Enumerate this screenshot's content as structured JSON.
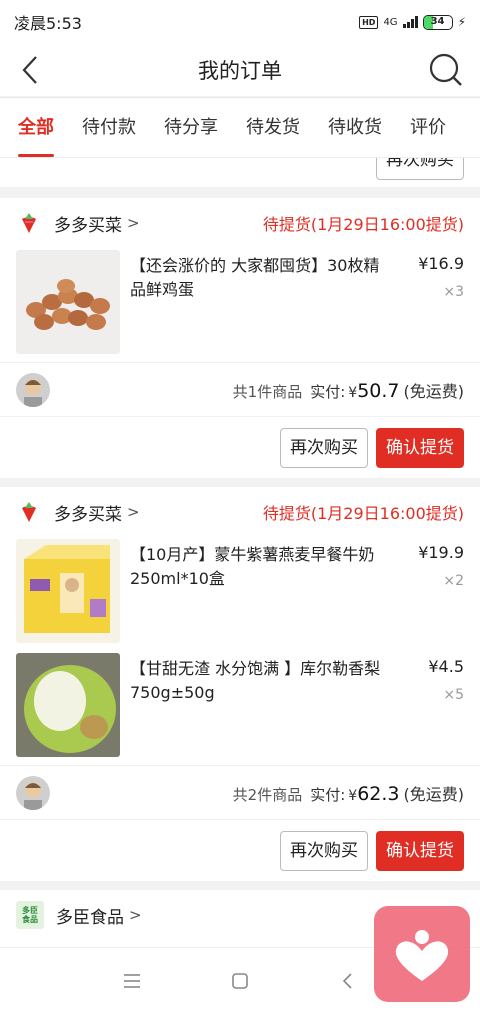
{
  "status_bar": {
    "time": "凌晨5:53",
    "hd": "HD",
    "network": "4G",
    "battery": "34",
    "battery_level": 0.34
  },
  "nav": {
    "title": "我的订单"
  },
  "tabs": [
    {
      "label": "全部",
      "active": true
    },
    {
      "label": "待付款",
      "active": false
    },
    {
      "label": "待分享",
      "active": false
    },
    {
      "label": "待发货",
      "active": false
    },
    {
      "label": "待收货",
      "active": false
    },
    {
      "label": "评价",
      "active": false
    }
  ],
  "prev_card": {
    "button": "再次购买"
  },
  "orders": [
    {
      "shop": "多多买菜",
      "status": "待提货(1月29日16:00提货)",
      "items": [
        {
          "title": "【还会涨价的 大家都囤货】30枚精品鲜鸡蛋",
          "price": "¥16.9",
          "qty": "×3"
        }
      ],
      "count_text": "共1件商品",
      "paid_label": "实付:",
      "currency": "¥",
      "total": "50.7",
      "shipping": "(免运费)",
      "buttons": {
        "rebuy": "再次购买",
        "confirm": "确认提货"
      }
    },
    {
      "shop": "多多买菜",
      "status": "待提货(1月29日16:00提货)",
      "items": [
        {
          "title": "【10月产】蒙牛紫薯燕麦早餐牛奶250ml*10盒",
          "price": "¥19.9",
          "qty": "×2"
        },
        {
          "title": "【甘甜无渣  水分饱满 】库尔勒香梨750g±50g",
          "price": "¥4.5",
          "qty": "×5"
        }
      ],
      "count_text": "共2件商品",
      "paid_label": "实付:",
      "currency": "¥",
      "total": "62.3",
      "shipping": "(免运费)",
      "buttons": {
        "rebuy": "再次购买",
        "confirm": "确认提货"
      }
    },
    {
      "shop": "多臣食品",
      "logo_text": "多臣\n食品",
      "status": ""
    }
  ],
  "colors": {
    "accent": "#e02e24",
    "background": "#f2f2f2"
  }
}
